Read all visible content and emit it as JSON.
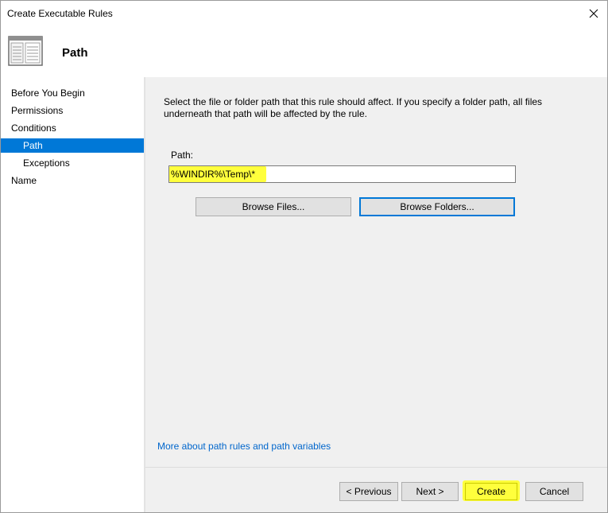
{
  "window": {
    "title": "Create Executable Rules",
    "close_glyph": "✕"
  },
  "header": {
    "title": "Path",
    "icon": "document-window-icon"
  },
  "nav": {
    "items": [
      {
        "label": "Before You Begin"
      },
      {
        "label": "Permissions"
      },
      {
        "label": "Conditions"
      },
      {
        "label": "Path"
      },
      {
        "label": "Exceptions"
      },
      {
        "label": "Name"
      }
    ],
    "active_index": 3
  },
  "main": {
    "description": "Select the file or folder path that this rule should affect. If you specify a folder path, all files underneath that path will be affected by the rule.",
    "path_label": "Path:",
    "path_value": "%WINDIR%\\Temp\\*",
    "browse_files_label": "Browse Files...",
    "browse_folders_label": "Browse Folders...",
    "more_link": "More about path rules and path variables"
  },
  "footer": {
    "previous_label": "< Previous",
    "next_label": "Next >",
    "create_label": "Create",
    "cancel_label": "Cancel"
  },
  "colors": {
    "accent": "#0078d7",
    "highlight": "#ffff3c",
    "link": "#0066cc",
    "panel_bg": "#f0f0f0"
  }
}
